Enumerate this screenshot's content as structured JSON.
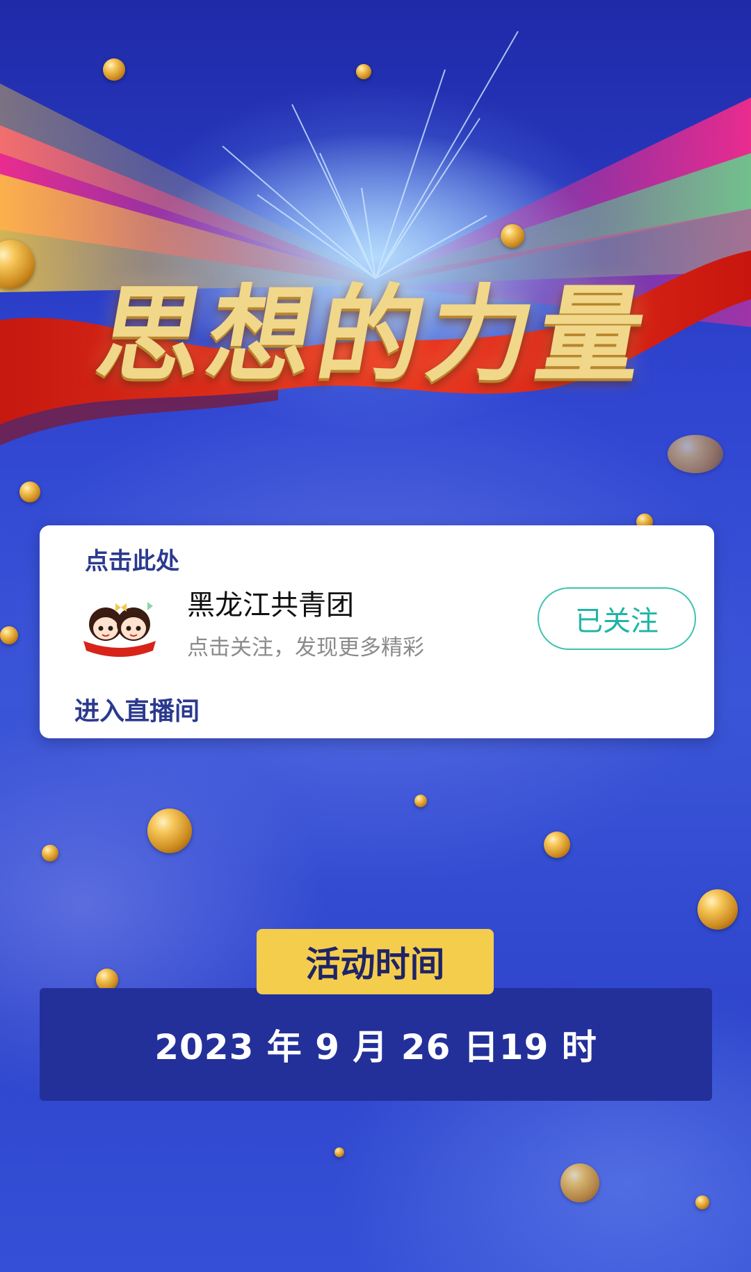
{
  "hero": {
    "title": "思想的力量"
  },
  "card": {
    "top_link": "点击此处",
    "account_name": "黑龙江共青团",
    "account_subtitle": "点击关注，发现更多精彩",
    "follow_button": "已关注",
    "enter_live": "进入直播间"
  },
  "event": {
    "label": "活动时间",
    "datetime": "2023 年 9 月 26 日19 时"
  },
  "colors": {
    "background": "#2f44d0",
    "card": "#ffffff",
    "follow_accent": "#1fb5a5",
    "link_text": "#2b3a8e",
    "time_label_bg": "#f4cd4d",
    "time_bar_bg": "#23309a",
    "title_gold": "#f1d78a",
    "ribbon_red": "#e0311f"
  }
}
